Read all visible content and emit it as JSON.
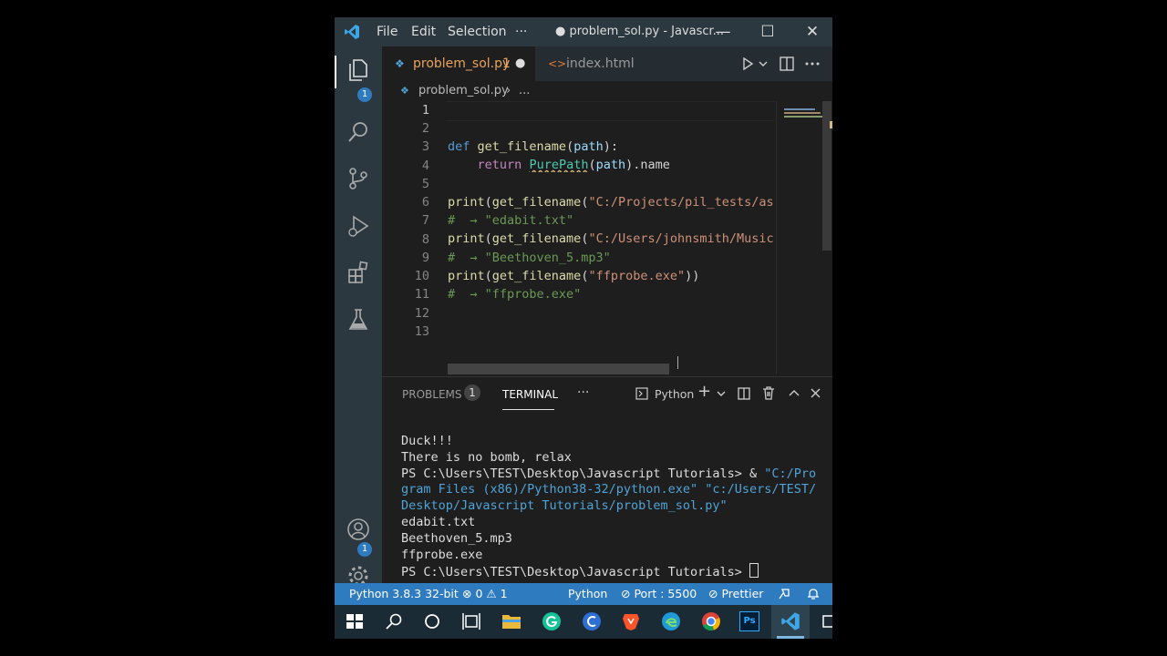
{
  "titlebar": {
    "menu": [
      "File",
      "Edit",
      "Selection",
      "···"
    ],
    "window_title": "● problem_sol.py - Javascr...",
    "minimize": "—",
    "maximize": "☐",
    "close": "✕"
  },
  "activity": {
    "explorer_badge": "1",
    "accounts_badge": "1",
    "icons": [
      "files-icon",
      "search-icon",
      "source-control-icon",
      "run-debug-icon",
      "extensions-icon",
      "testing-icon",
      "accounts-icon",
      "settings-gear-icon"
    ]
  },
  "tabs": [
    {
      "label": "problem_sol.py",
      "problem_count": "1",
      "modified": "●",
      "active": true
    },
    {
      "label": "index.html",
      "active": false
    }
  ],
  "breadcrumb": {
    "file": "problem_sol.py",
    "sep": "›",
    "more": "..."
  },
  "editor": {
    "line_numbers": [
      "1",
      "2",
      "3",
      "4",
      "5",
      "6",
      "7",
      "8",
      "9",
      "10",
      "11",
      "12",
      "13"
    ],
    "l2": {
      "kw": "def",
      "fn": "get_filename",
      "open": "(",
      "param": "path",
      "close": "):"
    },
    "l3": {
      "kw": "return",
      "cls": "PurePath",
      "open": "(",
      "param": "path",
      "close": ").name"
    },
    "l5": {
      "fn": "print",
      "open": "(",
      "fn2": "get_filename",
      "open2": "(",
      "str": "\"C:/Projects/pil_tests/as"
    },
    "l6": {
      "comment": "#  → \"edabit.txt\""
    },
    "l7": {
      "fn": "print",
      "open": "(",
      "fn2": "get_filename",
      "open2": "(",
      "str": "\"C:/Users/johnsmith/Music"
    },
    "l8": {
      "comment": "#  → \"Beethoven_5.mp3\""
    },
    "l9": {
      "fn": "print",
      "open": "(",
      "fn2": "get_filename",
      "open2": "(",
      "str": "\"ffprobe.exe\"",
      "close": "))"
    },
    "l10": {
      "comment": "#  → \"ffprobe.exe\""
    }
  },
  "panel": {
    "problems_label": "PROBLEMS",
    "problems_count": "1",
    "terminal_label": "TERMINAL",
    "more": "···",
    "shell": "Python",
    "add": "+",
    "dropdown": "⌄",
    "maximize": "⌃",
    "close": "✕"
  },
  "terminal": {
    "line1": "Duck!!!",
    "line2": "There is no bomb, relax",
    "line3_prompt": "PS C:\\Users\\TEST\\Desktop\\Javascript Tutorials> & ",
    "line3_str": "\"C:/Pro",
    "line4_str": "gram Files (x86)/Python38-32/python.exe\" \"c:/Users/TEST/",
    "line5_str": "Desktop/Javascript Tutorials/problem_sol.py\"",
    "line6": "edabit.txt",
    "line7": "Beethoven_5.mp3",
    "line8": "ffprobe.exe",
    "line9": "PS C:\\Users\\TEST\\Desktop\\Javascript Tutorials> "
  },
  "status": {
    "interpreter": "Python 3.8.3 32-bit",
    "errors": "0",
    "warnings": "1",
    "language": "Python",
    "port": "Port : 5500",
    "prettier": "Prettier"
  },
  "taskbar": {
    "icons": [
      "windows-start-icon",
      "search-icon",
      "cortana-icon",
      "task-view-icon",
      "file-explorer-icon",
      "grammarly-icon",
      "ccleaner-icon",
      "brave-icon",
      "edge-icon",
      "chrome-icon",
      "photoshop-icon",
      "vscode-icon",
      "overflow-icon"
    ],
    "photoshop_label": "Ps"
  },
  "colors": {
    "status_bar": "#2f7bbf",
    "activity_bar": "#2b3840",
    "editor_bg": "#1e1e1e",
    "active_tab_text": "#e8a35c"
  }
}
